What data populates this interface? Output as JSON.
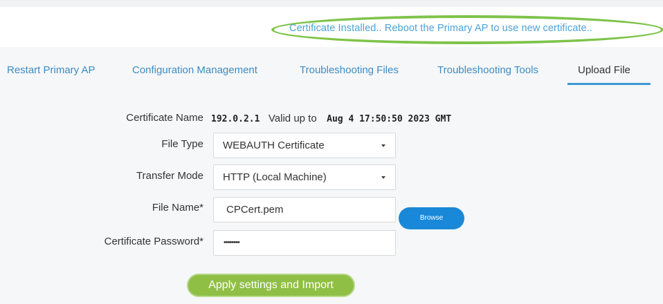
{
  "notice": {
    "text": "Certificate Installed.. Reboot the Primary AP to use new certificate.."
  },
  "tabs": [
    {
      "label": "Restart Primary AP",
      "active": false
    },
    {
      "label": "Configuration Management",
      "active": false
    },
    {
      "label": "Troubleshooting Files",
      "active": false
    },
    {
      "label": "Troubleshooting Tools",
      "active": false
    },
    {
      "label": "Upload File",
      "active": true
    }
  ],
  "form": {
    "certificate": {
      "label": "Certificate Name",
      "name": "192.0.2.1",
      "valid_label": "Valid up to",
      "valid_date": "Aug 4 17:50:50 2023 GMT"
    },
    "file_type": {
      "label": "File Type",
      "value": "WEBAUTH Certificate"
    },
    "transfer_mode": {
      "label": "Transfer Mode",
      "value": "HTTP (Local Machine)"
    },
    "file_name": {
      "label": "File Name*",
      "value": "CPCert.pem",
      "browse_label": "Browse"
    },
    "certificate_password": {
      "label": "Certificate Password*",
      "value": "••••••••"
    },
    "apply_label": "Apply settings and Import"
  },
  "colors": {
    "accent_blue": "#3d98d3",
    "browse_blue": "#1a88d8",
    "apply_green": "#8fbf45",
    "highlight_green": "#7ec34a"
  }
}
